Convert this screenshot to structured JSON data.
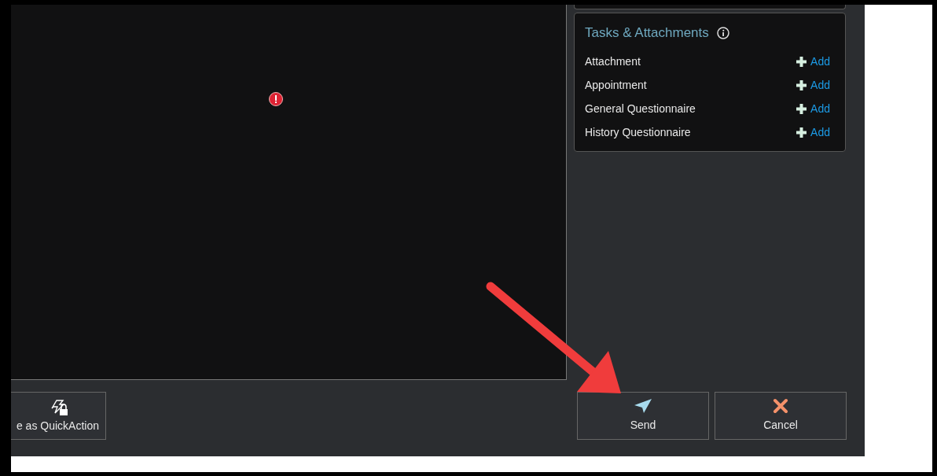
{
  "tasks_panel": {
    "title": "Tasks & Attachments",
    "items": [
      {
        "label": "Attachment",
        "action": "Add"
      },
      {
        "label": "Appointment",
        "action": "Add"
      },
      {
        "label": "General Questionnaire",
        "action": "Add"
      },
      {
        "label": "History Questionnaire",
        "action": "Add"
      }
    ]
  },
  "footer": {
    "quickaction_button": "e as QuickAction",
    "send_button": "Send",
    "cancel_button": "Cancel"
  }
}
